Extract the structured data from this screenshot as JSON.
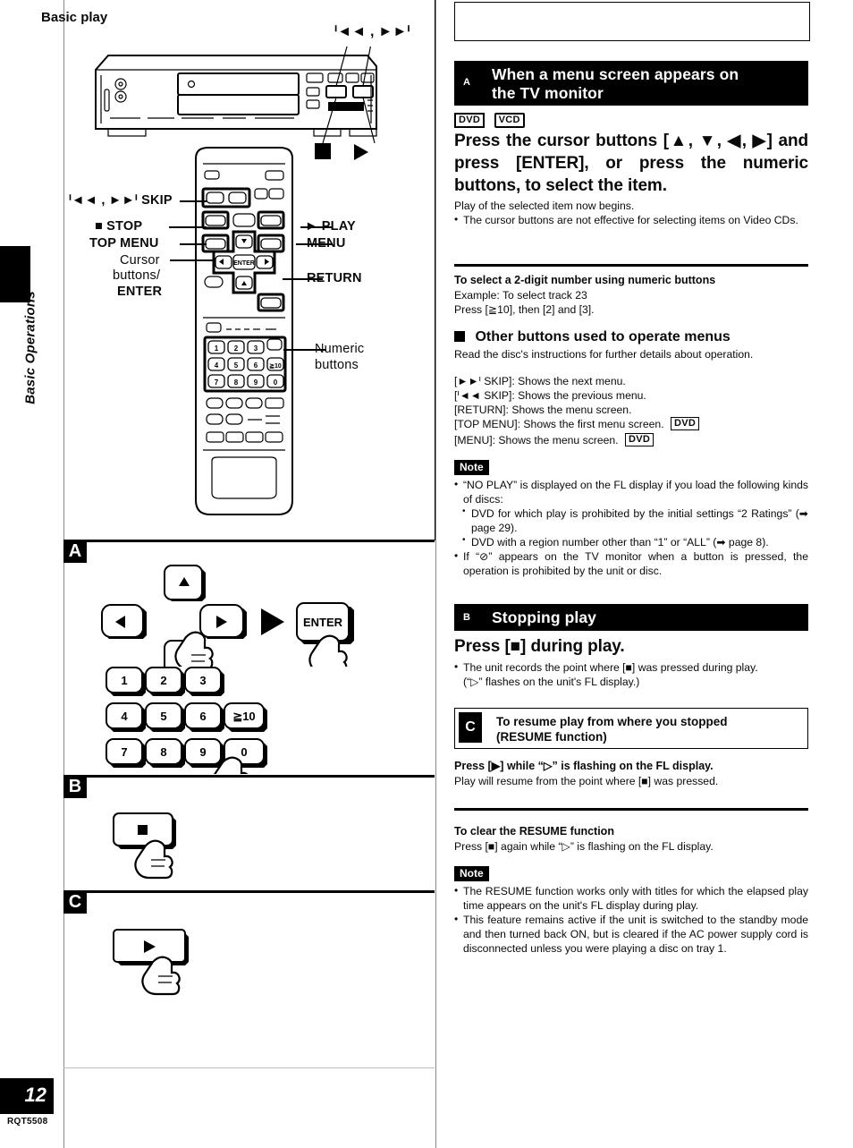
{
  "page": {
    "number": "12",
    "model_code": "RQT5508",
    "chapter_tab": "Basic Operations"
  },
  "header": {
    "title": "Basic play"
  },
  "left_figure": {
    "top_callouts": {
      "skip_marks": "ᑊ◄◄ ,  ►►ᑊ",
      "stop_mark": "■",
      "play_mark": "►"
    },
    "labels": {
      "skip": "ᑊ◄◄ , ►►ᑊ SKIP",
      "stop": "■ STOP",
      "top_menu": "TOP MENU",
      "cursor_line1": "Cursor",
      "cursor_line2": "buttons/",
      "cursor_line3": "ENTER",
      "play": "► PLAY",
      "menu": "MENU",
      "return": "RETURN",
      "numeric_line1": "Numeric",
      "numeric_line2": "buttons"
    },
    "enter_key_label": "ENTER",
    "numeric_keys": [
      "1",
      "2",
      "3",
      "4",
      "5",
      "6",
      "≧10",
      "7",
      "8",
      "9",
      "0"
    ],
    "step_badges": [
      "A",
      "B",
      "C"
    ]
  },
  "section_a": {
    "letter": "A",
    "title_line1": "When a menu screen appears on",
    "title_line2": "the TV monitor",
    "disc_tags": [
      "DVD",
      "VCD"
    ],
    "headline": "Press the cursor buttons [▲, ▼, ◀, ▶] and press [ENTER], or press the numeric buttons, to select the item.",
    "body_line": "Play of the selected item now begins.",
    "bullet1": "The cursor buttons are not effective for selecting items on Video CDs.",
    "twodigit": {
      "heading": "To select a 2-digit number using numeric buttons",
      "line1": "Example:  To select track 23",
      "line2": "Press [≧10], then [2] and [3]."
    },
    "other_buttons": {
      "heading": "Other buttons used to operate menus",
      "intro": "Read the disc's instructions for further details about operation.",
      "items": [
        {
          "text": "[►►ᑊ SKIP]: Shows the next menu.",
          "tag": ""
        },
        {
          "text": "[ᑊ◄◄ SKIP]: Shows the previous menu.",
          "tag": ""
        },
        {
          "text": "[RETURN]: Shows the menu screen.",
          "tag": ""
        },
        {
          "text": "[TOP MENU]: Shows the first menu screen.",
          "tag": "DVD"
        },
        {
          "text": "[MENU]: Shows the menu screen.",
          "tag": "DVD"
        }
      ]
    },
    "note": {
      "label": "Note",
      "b1": "“NO PLAY” is displayed on the FL display if you load the following kinds of discs:",
      "s1": "DVD for which play is prohibited by the initial settings “2 Ratings” (➡ page 29).",
      "s2": "DVD with a region number other than “1” or “ALL” (➡ page 8).",
      "b2": "If “⊘” appears on the TV monitor when a button is pressed, the operation is prohibited by the unit or disc."
    }
  },
  "section_b": {
    "letter": "B",
    "title": "Stopping play",
    "headline": "Press [■] during play.",
    "bullet1": "The unit records the point where [■] was pressed during play.",
    "bullet1_cont": "(“▷” flashes on the unit's FL display.)"
  },
  "section_c": {
    "letter": "C",
    "title_line1": "To resume play from where you stopped",
    "title_line2": "(RESUME function)",
    "line1": "Press [▶] while “▷” is flashing on the FL display.",
    "line2": "Play will resume from the point where [■] was pressed.",
    "clear": {
      "heading": "To clear the RESUME function",
      "line1": "Press [■] again while “▷” is flashing on the FL display."
    },
    "note": {
      "label": "Note",
      "b1": "The RESUME function works only with titles for which the elapsed play time appears on the unit's FL display during play.",
      "b2": "This feature remains active if the unit is switched to the standby mode and then turned back ON, but is cleared if the AC power supply cord is disconnected unless you were playing a disc on tray 1."
    }
  }
}
